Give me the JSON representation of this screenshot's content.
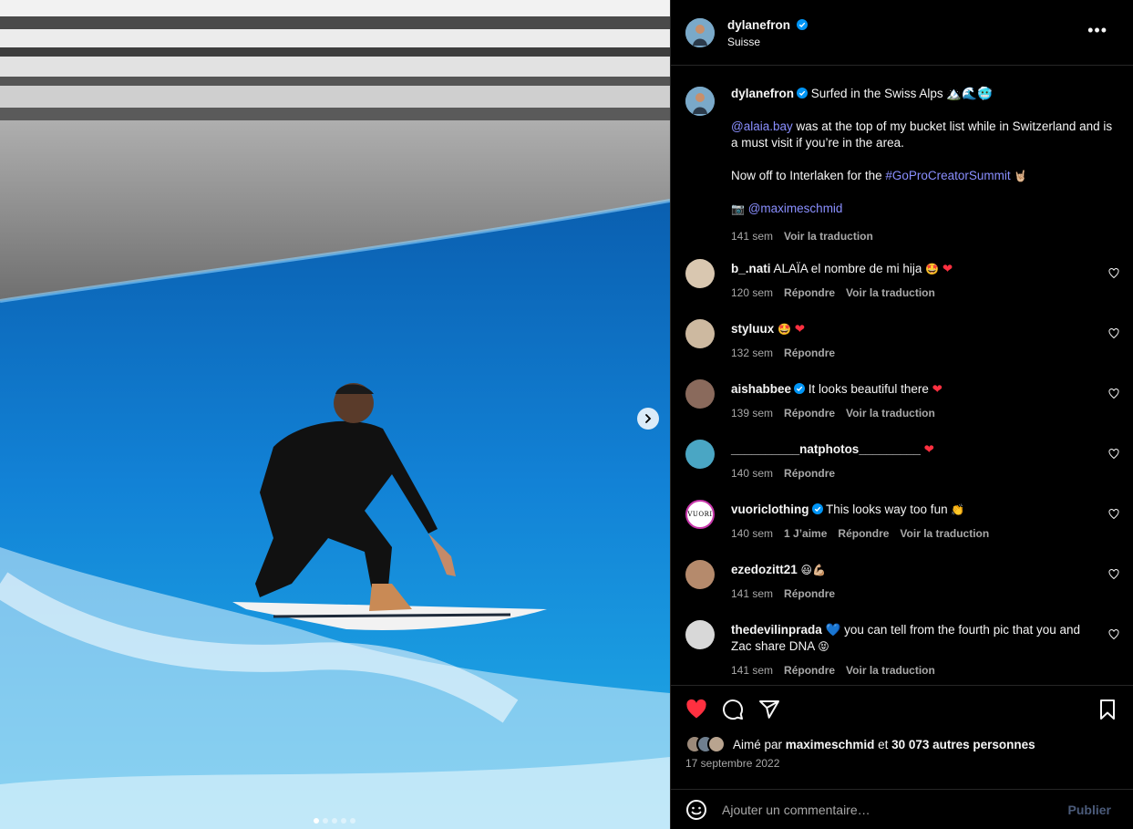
{
  "post": {
    "username": "dylanefron",
    "location": "Suisse",
    "caption_title": "Surfed in the Swiss Alps 🏔️🌊🥶",
    "caption_line1_mention": "@alaia.bay",
    "caption_line1_rest": " was at the top of my bucket list while in Switzerland and is a must visit if you’re in the area.",
    "caption_line2_text": "Now off to Interlaken for the ",
    "caption_line2_hashtag": "#GoProCreatorSummit",
    "caption_line2_emoji": "🤘🏼",
    "caption_photo_icon": "📷",
    "caption_photo_credit": "@maximeschmid",
    "caption_time": "141 sem",
    "caption_translate": "Voir la traduction",
    "more_label": "•••"
  },
  "comments": [
    {
      "user": "b_.nati",
      "text": "ALAÏA el nombre de mi hija ",
      "emoji": "🤩",
      "heart": "❤",
      "time": "120 sem",
      "reply": "Répondre",
      "translate": "Voir la traduction"
    },
    {
      "user": "styluux",
      "text": "",
      "emoji": "🤩",
      "heart": "❤",
      "time": "132 sem",
      "reply": "Répondre"
    },
    {
      "user": "aishabbee",
      "text": "It looks beautiful there ",
      "emoji": "",
      "heart": "❤",
      "time": "139 sem",
      "reply": "Répondre",
      "translate": "Voir la traduction"
    },
    {
      "user": "__________natphotos_________",
      "text": "",
      "emoji": "",
      "heart": "❤",
      "time": "140 sem",
      "reply": "Répondre"
    },
    {
      "user": "vuoriclothing",
      "text": "This looks way too fun ",
      "emoji": "👏",
      "time": "140 sem",
      "likes": "1 J’aime",
      "reply": "Répondre",
      "translate": "Voir la traduction",
      "avatar_text": "VUORI"
    },
    {
      "user": "ezedozitt21",
      "text": "",
      "emoji": "😃💪🏼",
      "time": "141 sem",
      "reply": "Répondre"
    },
    {
      "user": "thedevilinprada",
      "heart": "💙",
      "text": " you can tell from the fourth pic that you and Zac share DNA ",
      "emoji": "😝",
      "time": "141 sem",
      "reply": "Répondre",
      "translate": "Voir la traduction"
    }
  ],
  "likes": {
    "prefix": "Aimé par ",
    "user": "maximeschmid",
    "middle": " et ",
    "count": "30 073 autres personnes"
  },
  "date": "17 septembre 2022",
  "add_comment": {
    "placeholder": "Ajouter un commentaire…",
    "publish": "Publier"
  },
  "colors": {
    "background": "#000000",
    "link": "#8a8fff",
    "like_red": "#ff3040",
    "verified": "#0095f6",
    "muted": "#a8a8a8"
  },
  "carousel": {
    "count": 5,
    "active": 1
  }
}
